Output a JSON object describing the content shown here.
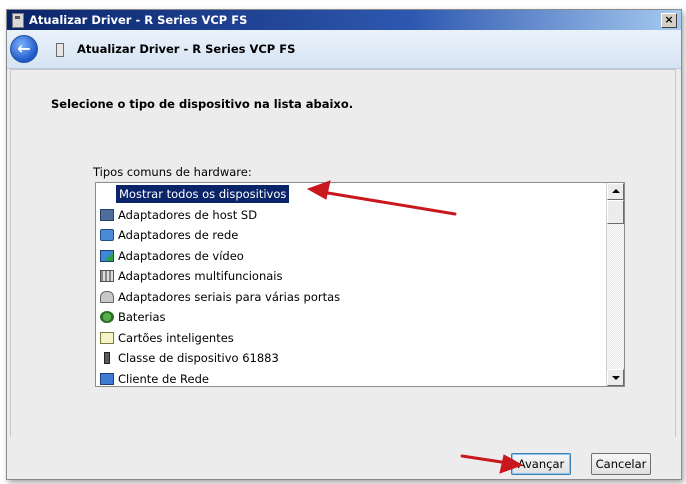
{
  "window": {
    "title": "Atualizar Driver -  R Series VCP FS",
    "close_glyph": "×"
  },
  "header": {
    "back_glyph": "←",
    "title": "Atualizar Driver -  R Series VCP FS"
  },
  "content": {
    "instruction": "Selecione o tipo de dispositivo na lista abaixo.",
    "list_label": "Tipos comuns de hardware:",
    "items": [
      {
        "label": "Mostrar todos os dispositivos",
        "icon": "none"
      },
      {
        "label": "Adaptadores de host SD",
        "icon": "sd-host-icon"
      },
      {
        "label": "Adaptadores de rede",
        "icon": "network-adapter-icon"
      },
      {
        "label": "Adaptadores de vídeo",
        "icon": "video-adapter-icon"
      },
      {
        "label": "Adaptadores multifuncionais",
        "icon": "multifunction-icon"
      },
      {
        "label": "Adaptadores seriais para várias portas",
        "icon": "serial-port-icon"
      },
      {
        "label": "Baterias",
        "icon": "battery-icon"
      },
      {
        "label": "Cartões inteligentes",
        "icon": "smart-card-icon"
      },
      {
        "label": "Classe de dispositivo 61883",
        "icon": "device-class-icon"
      },
      {
        "label": "Cliente de Rede",
        "icon": "network-client-icon"
      }
    ],
    "selected_index": 0
  },
  "footer": {
    "next_label": "Avançar",
    "cancel_label": "Cancelar"
  },
  "colors": {
    "selection": "#0a246a",
    "annotation_arrow": "#c8181e"
  }
}
